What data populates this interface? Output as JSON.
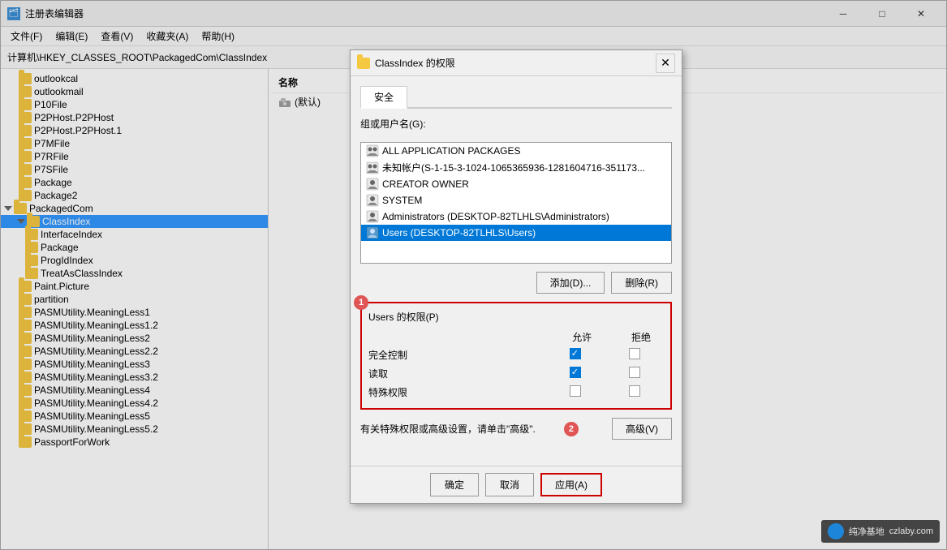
{
  "app": {
    "title": "注册表编辑器",
    "icon": "🗂"
  },
  "menu": {
    "items": [
      "文件(F)",
      "编辑(E)",
      "查看(V)",
      "收藏夹(A)",
      "帮助(H)"
    ]
  },
  "address": {
    "path": "计算机\\HKEY_CLASSES_ROOT\\PackagedCom\\ClassIndex"
  },
  "tree": {
    "items": [
      {
        "label": "outlookcal",
        "level": 1,
        "expanded": false
      },
      {
        "label": "outlookmail",
        "level": 1,
        "expanded": false
      },
      {
        "label": "P10File",
        "level": 1,
        "expanded": false
      },
      {
        "label": "P2PHost.P2PHost",
        "level": 1,
        "expanded": false
      },
      {
        "label": "P2PHost.P2PHost.1",
        "level": 1,
        "expanded": false
      },
      {
        "label": "P7MFile",
        "level": 1,
        "expanded": false
      },
      {
        "label": "P7RFile",
        "level": 1,
        "expanded": false
      },
      {
        "label": "P7SFile",
        "level": 1,
        "expanded": false
      },
      {
        "label": "Package",
        "level": 1,
        "expanded": false
      },
      {
        "label": "Package2",
        "level": 1,
        "expanded": false
      },
      {
        "label": "PackagedCom",
        "level": 1,
        "expanded": true
      },
      {
        "label": "ClassIndex",
        "level": 2,
        "expanded": true,
        "selected": true
      },
      {
        "label": "InterfaceIndex",
        "level": 2,
        "expanded": false
      },
      {
        "label": "Package",
        "level": 2,
        "expanded": false
      },
      {
        "label": "ProgIdIndex",
        "level": 2,
        "expanded": false
      },
      {
        "label": "TreatAsClassIndex",
        "level": 2,
        "expanded": false
      },
      {
        "label": "Paint.Picture",
        "level": 1,
        "expanded": false
      },
      {
        "label": "partition",
        "level": 1,
        "expanded": false
      },
      {
        "label": "PASMUtility.MeaningLess1",
        "level": 1,
        "expanded": false
      },
      {
        "label": "PASMUtility.MeaningLess1.2",
        "level": 1,
        "expanded": false
      },
      {
        "label": "PASMUtility.MeaningLess2",
        "level": 1,
        "expanded": false
      },
      {
        "label": "PASMUtility.MeaningLess2.2",
        "level": 1,
        "expanded": false
      },
      {
        "label": "PASMUtility.MeaningLess3",
        "level": 1,
        "expanded": false
      },
      {
        "label": "PASMUtility.MeaningLess3.2",
        "level": 1,
        "expanded": false
      },
      {
        "label": "PASMUtility.MeaningLess4",
        "level": 1,
        "expanded": false
      },
      {
        "label": "PASMUtility.MeaningLess4.2",
        "level": 1,
        "expanded": false
      },
      {
        "label": "PASMUtility.MeaningLess5",
        "level": 1,
        "expanded": false
      },
      {
        "label": "PASMUtility.MeaningLess5.2",
        "level": 1,
        "expanded": false
      },
      {
        "label": "PassportForWork",
        "level": 1,
        "expanded": false
      }
    ]
  },
  "right_panel": {
    "header": "名称",
    "items": [
      {
        "label": "(默认)"
      }
    ]
  },
  "dialog": {
    "title": "ClassIndex 的权限",
    "close_btn": "✕",
    "tabs": [
      "安全"
    ],
    "active_tab": "安全",
    "group_label": "组或用户名(G):",
    "users": [
      {
        "label": "ALL APPLICATION PACKAGES",
        "type": "group"
      },
      {
        "label": "未知帐户(S-1-15-3-1024-1065365936-1281604716-351173...",
        "type": "unknown"
      },
      {
        "label": "CREATOR OWNER",
        "type": "user"
      },
      {
        "label": "SYSTEM",
        "type": "user"
      },
      {
        "label": "Administrators (DESKTOP-82TLHLS\\Administrators)",
        "type": "user"
      },
      {
        "label": "Users (DESKTOP-82TLHLS\\Users)",
        "type": "user",
        "selected": true
      }
    ],
    "add_btn": "添加(D)...",
    "remove_btn": "删除(R)",
    "perm_label": "Users 的权限(P)",
    "perm_columns": [
      "允许",
      "拒绝"
    ],
    "permissions": [
      {
        "name": "完全控制",
        "allow": true,
        "deny": false
      },
      {
        "name": "读取",
        "allow": true,
        "deny": false
      },
      {
        "name": "特殊权限",
        "allow": false,
        "deny": false
      }
    ],
    "advanced_text": "有关特殊权限或高级设置，请单击\"高级\".",
    "advanced_btn": "高级(V)",
    "ok_btn": "确定",
    "cancel_btn": "取消",
    "apply_btn": "应用(A)",
    "num1": "1",
    "num2": "2"
  },
  "watermark": {
    "text": "纯净基地",
    "url": "czlaby.com"
  }
}
